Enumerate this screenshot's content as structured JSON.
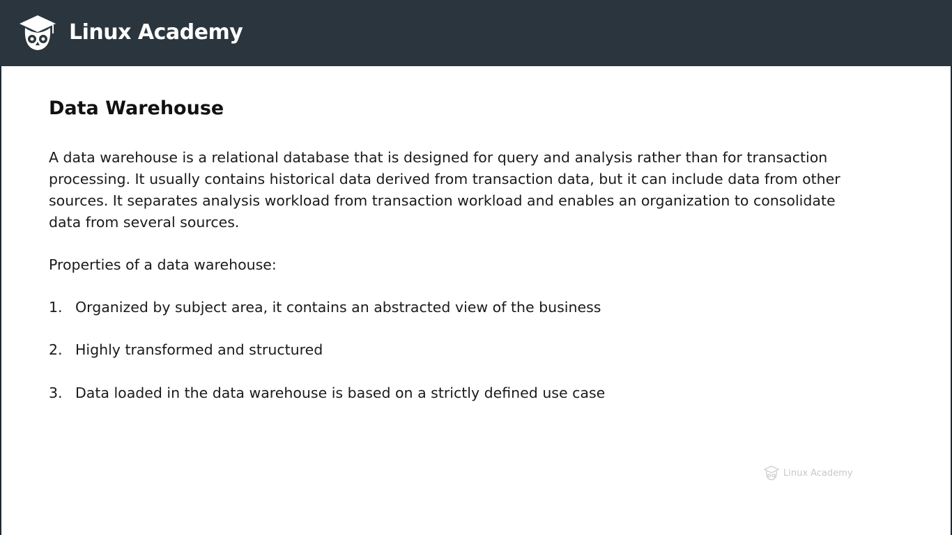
{
  "header": {
    "brand_name": "Linux Academy",
    "logo_icon": "owl-graduation-cap-icon",
    "background_color": "#2b353d"
  },
  "slide": {
    "title": "Data Warehouse",
    "paragraph": "A data warehouse is a relational database that is designed for query and analysis rather than for transaction processing. It usually contains historical data derived from transaction data, but it can include data from other sources. It separates analysis workload from transaction workload and enables an organization to consolidate data from several sources.",
    "properties_label": "Properties of a data warehouse:",
    "properties": [
      {
        "number": "1.",
        "text": "Organized by subject area, it contains an abstracted view of the business"
      },
      {
        "number": "2.",
        "text": "Highly transformed and structured"
      },
      {
        "number": "3.",
        "text": "Data loaded in the data warehouse is based on a strictly defined use case"
      }
    ]
  },
  "watermark": {
    "text": "Linux Academy",
    "icon": "owl-graduation-cap-icon"
  }
}
